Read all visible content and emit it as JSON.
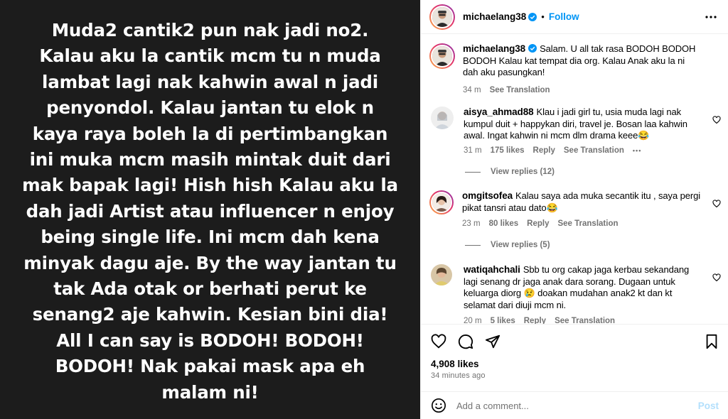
{
  "post_image": {
    "text": "Muda2 cantik2 pun nak jadi no2.\nKalau aku la cantik mcm tu n muda\nlambat lagi nak kahwin awal n jadi\npenyondol. Kalau jantan tu elok n\nkaya raya boleh la di pertimbangkan\nini muka mcm masih mintak duit dari\nmak bapak lagi! Hish hish Kalau aku la\ndah jadi Artist atau influencer n enjoy\nbeing single life. Ini mcm dah kena\nminyak dagu aje. By the way jantan tu\ntak Ada otak or berhati perut ke\nsenang2 aje kahwin. Kesian bini dia!\nAll I can say is BODOH! BODOH!\nBODOH! Nak pakai mask apa eh\nmalam ni!"
  },
  "header": {
    "username": "michaelang38",
    "separator": "•",
    "follow_label": "Follow"
  },
  "caption": {
    "username": "michaelang38",
    "text": "Salam. U all tak rasa BODOH BODOH BODOH Kalau kat tempat dia org. Kalau Anak aku la ni dah aku pasungkan!",
    "time": "34 m",
    "translate": "See Translation"
  },
  "comments": [
    {
      "username": "aisya_ahmad88",
      "text": "Klau i jadi girl tu, usia muda lagi nak kumpul duit + happykan diri, travel je. Bosan laa kahwin awal. Ingat kahwin ni mcm dlm drama keee😂",
      "time": "31 m",
      "likes": "175 likes",
      "reply": "Reply",
      "translate": "See Translation",
      "more": "•••",
      "view_replies": "View replies (12)"
    },
    {
      "username": "omgitsofea",
      "text": "Kalau saya ada muka secantik itu , saya pergi pikat tansri atau dato😂",
      "time": "23 m",
      "likes": "80 likes",
      "reply": "Reply",
      "translate": "See Translation",
      "view_replies": "View replies (5)"
    },
    {
      "username": "watiqahchali",
      "text": "Sbb tu org cakap jaga kerbau sekandang lagi senang dr jaga anak dara sorang. Dugaan untuk keluarga diorg 😢 doakan mudahan anak2 kt dan kt selamat dari diuji mcm ni.",
      "time": "20 m",
      "likes": "5 likes",
      "reply": "Reply",
      "translate": "See Translation"
    }
  ],
  "actions": {
    "likes": "4,908 likes",
    "time": "34 minutes ago"
  },
  "add_comment": {
    "placeholder": "Add a comment...",
    "post_label": "Post"
  },
  "colors": {
    "link_blue": "#0095f6",
    "post_disabled": "#b2dffc",
    "muted": "#737373",
    "image_bg": "#1c1c1c"
  },
  "icons": [
    "verified-badge-icon",
    "more-options-icon",
    "heart-icon",
    "comment-icon",
    "share-icon",
    "save-bookmark-icon",
    "emoji-icon"
  ]
}
